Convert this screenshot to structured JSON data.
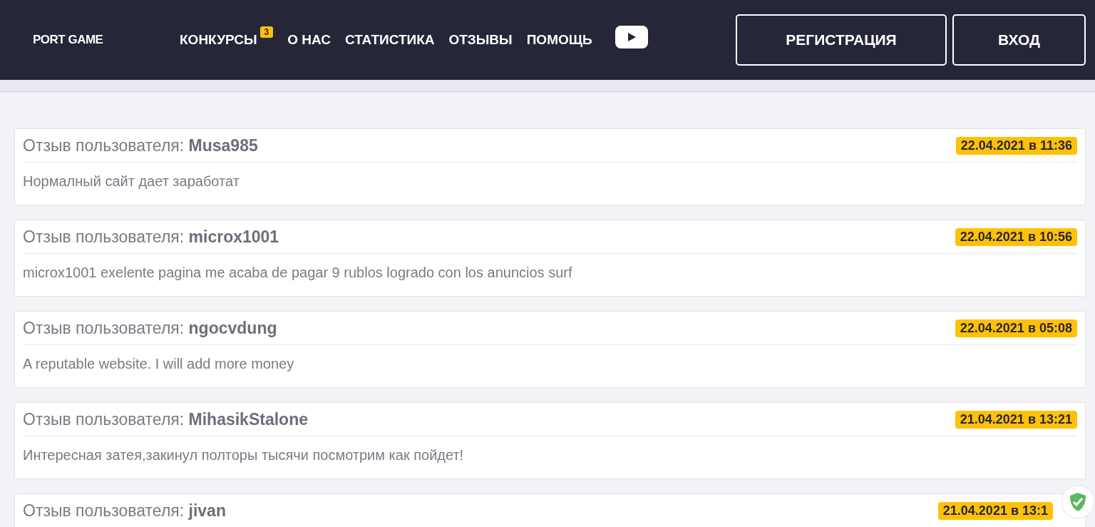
{
  "header": {
    "logo": "PORT GAME",
    "nav": [
      {
        "label": "КОНКУРСЫ",
        "badge": "3"
      },
      {
        "label": "О НАС"
      },
      {
        "label": "СТАТИСТИКА"
      },
      {
        "label": "ОТЗЫВЫ"
      },
      {
        "label": "ПОМОЩЬ"
      }
    ],
    "buttons": [
      "РЕГИСТРАЦИЯ",
      "ВХОД"
    ]
  },
  "reviews": [
    {
      "label": "Отзыв пользователя:",
      "user": "Musa985",
      "date": "22.04.2021 в 11:36",
      "text": "Нормалный сайт дает заработат"
    },
    {
      "label": "Отзыв пользователя:",
      "user": "microx1001",
      "date": "22.04.2021 в 10:56",
      "text": "microx1001 exelente pagina me acaba de pagar 9 rublos logrado con los anuncios surf"
    },
    {
      "label": "Отзыв пользователя:",
      "user": "ngocvdung",
      "date": "22.04.2021 в 05:08",
      "text": "A reputable website. I will add more money"
    },
    {
      "label": "Отзыв пользователя:",
      "user": "MihasikStalone",
      "date": "21.04.2021 в 13:21",
      "text": "Интересная затея,закинул полторы тысячи посмотрим как пойдет!"
    },
    {
      "label": "Отзыв пользователя:",
      "user": "jivan",
      "date": "21.04.2021 в 13:1"
    }
  ]
}
